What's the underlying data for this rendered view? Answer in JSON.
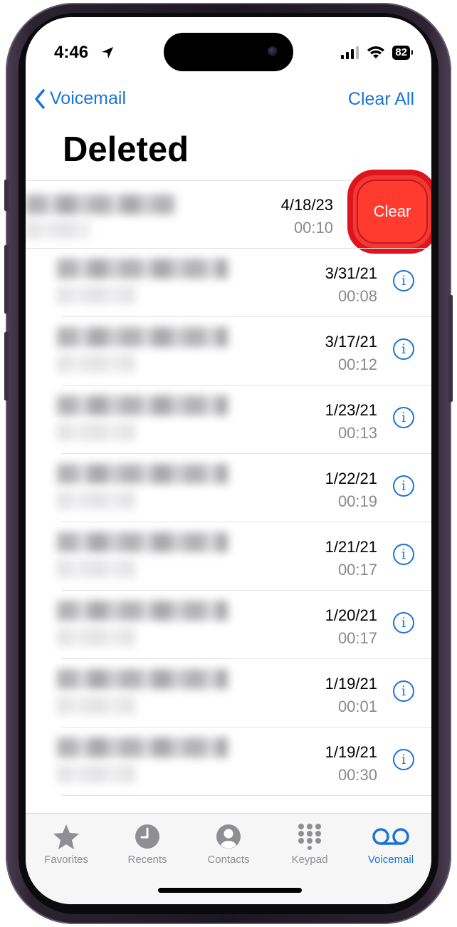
{
  "status": {
    "time": "4:46",
    "battery": "82"
  },
  "nav": {
    "back_label": "Voicemail",
    "right_action": "Clear All"
  },
  "page": {
    "title": "Deleted"
  },
  "swipe_action": {
    "label": "Clear",
    "color": "#ff3b30"
  },
  "voicemails": [
    {
      "date": "4/18/23",
      "duration": "00:10"
    },
    {
      "date": "3/31/21",
      "duration": "00:08"
    },
    {
      "date": "3/17/21",
      "duration": "00:12"
    },
    {
      "date": "1/23/21",
      "duration": "00:13"
    },
    {
      "date": "1/22/21",
      "duration": "00:19"
    },
    {
      "date": "1/21/21",
      "duration": "00:17"
    },
    {
      "date": "1/20/21",
      "duration": "00:17"
    },
    {
      "date": "1/19/21",
      "duration": "00:01"
    },
    {
      "date": "1/19/21",
      "duration": "00:30"
    }
  ],
  "tabs": [
    {
      "label": "Favorites",
      "icon": "star-icon",
      "active": false
    },
    {
      "label": "Recents",
      "icon": "clock-icon",
      "active": false
    },
    {
      "label": "Contacts",
      "icon": "person-circle-icon",
      "active": false
    },
    {
      "label": "Keypad",
      "icon": "keypad-grid-icon",
      "active": false
    },
    {
      "label": "Voicemail",
      "icon": "voicemail-icon",
      "active": true
    }
  ],
  "colors": {
    "accent": "#1a74d8",
    "destructive": "#ff3b30",
    "secondary_text": "#8a8a8e"
  }
}
